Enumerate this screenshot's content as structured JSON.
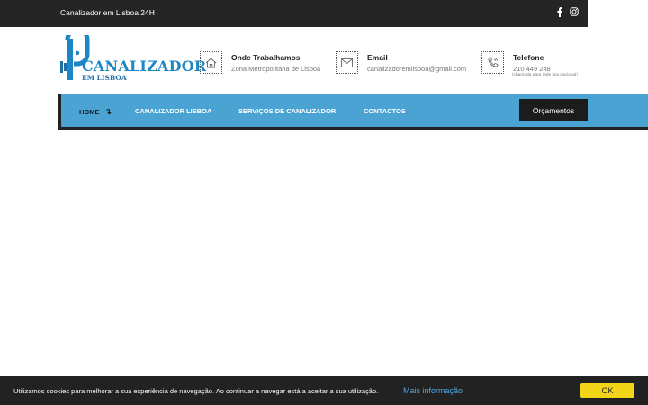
{
  "topbar": {
    "tagline": "Canalizador em Lisboa 24H",
    "social": [
      {
        "icon": "facebook-icon"
      },
      {
        "icon": "instagram-icon"
      }
    ]
  },
  "logo": {
    "brand": "CANALIZADOR",
    "sub": "EM LISBOA",
    "color": "#1e86c4"
  },
  "header_info": {
    "where": {
      "title": "Onde Trabalhamos",
      "value": "Zona Metropolitana de Lisboa",
      "icon": "home-icon"
    },
    "email": {
      "title": "Email",
      "value": "canalizadoremlisboa@gmail.com",
      "icon": "envelope-icon"
    },
    "phone": {
      "title": "Telefone",
      "value": "210 449 248",
      "note": "(chamada para rede fixa nacional)",
      "icon": "phone-icon"
    }
  },
  "nav": {
    "items": [
      {
        "label": "HOME",
        "icon": "arrow-down-icon"
      },
      {
        "label": "CANALIZADOR LISBOA"
      },
      {
        "label": "SERVIÇOS DE CANALIZADOR"
      },
      {
        "label": "CONTACTOS"
      }
    ],
    "cta_label": "Orçamentos",
    "bar_color": "#4aa3d3"
  },
  "cookie": {
    "message": "Utilizamos cookies para melhorar a sua experiência de navegação. Ao continuar a navegar está a aceitar a sua utilização.",
    "more_label": "Mais informação",
    "ok_label": "OK",
    "ok_color": "#f2d516"
  }
}
